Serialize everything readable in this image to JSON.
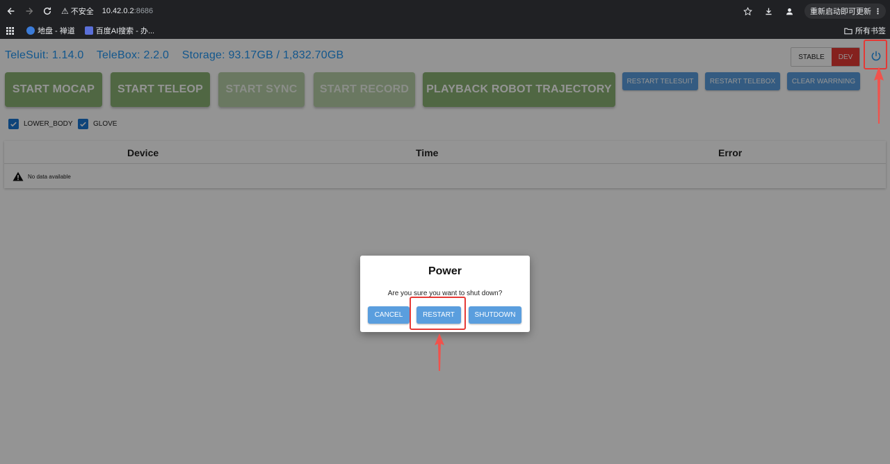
{
  "browser": {
    "security_label": "不安全",
    "url_host": "10.42.0.2",
    "url_port": ":8686",
    "update_label": "重新启动即可更新",
    "bookmarks": [
      {
        "label": "地盘 - 禅道",
        "color": "#3b7bd8"
      },
      {
        "label": "百度AI搜索 - 办...",
        "color": "#5a6fd8"
      }
    ],
    "all_bookmarks_label": "所有书签"
  },
  "header": {
    "telesuit": "TeleSuit:  1.14.0",
    "telebox": "TeleBox:  2.2.0",
    "storage": "Storage: 93.17GB / 1,832.70GB",
    "mode_stable": "STABLE",
    "mode_dev": "DEV"
  },
  "actions": {
    "start_mocap": "START MOCAP",
    "start_teleop": "START TELEOP",
    "start_sync": "START SYNC",
    "start_record": "START RECORD",
    "playback": "PLAYBACK ROBOT TRAJECTORY",
    "restart_telesuit": "RESTART TELESUIT",
    "restart_telebox": "RESTART TELEBOX",
    "clear_warning": "CLEAR WARRNING"
  },
  "options": {
    "lower_body": "LOWER_BODY",
    "glove": "GLOVE"
  },
  "table": {
    "columns": [
      "Device",
      "Time",
      "Error"
    ],
    "empty_text": "No data available"
  },
  "dialog": {
    "title": "Power",
    "message": "Are you sure you want to shut down?",
    "cancel": "CANCEL",
    "restart": "RESTART",
    "shutdown": "SHUTDOWN"
  },
  "colors": {
    "accent_blue": "#2196f3",
    "button_blue": "#5a9ede",
    "green": "#8bb274",
    "dev_red": "#e53935",
    "annotation_red": "#e53935"
  }
}
